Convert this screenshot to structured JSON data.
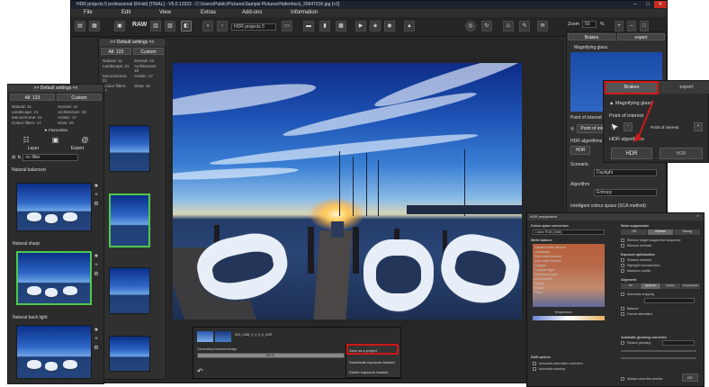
{
  "window": {
    "title": "HDR projects 5 professional (64-bit) [TRIAL] - V5.0.12933 - C:\\Users\\Public\\Pictures\\Sample Pictures\\Hafenhock_2564701h.jpg [+2]",
    "controls": [
      "–",
      "□",
      "✕"
    ]
  },
  "menu": [
    "File",
    "Edit",
    "View",
    "Extras",
    "Add-ons",
    "Information"
  ],
  "toolbar": {
    "raw_label": "RAW",
    "project_dropdown": "HDR projects 5",
    "zoom_label": "Zoom",
    "zoom_value": "50",
    "percent": "%"
  },
  "left_panel": {
    "header": ">> Default settings <<",
    "tabs": [
      "All: 123",
      "Custom"
    ],
    "categories": [
      [
        "Natural: 21",
        "Surreal: 13"
      ],
      [
        "Landscape: 21",
        "Architecture: 18"
      ],
      [
        "Monochrome: 21",
        "Artistic: 17"
      ],
      [
        "Colour filters: 17",
        "Glow: 16"
      ]
    ],
    "favourites": "Favourites",
    "layer_label": "Layer",
    "expert_label": "Expert",
    "filter_dropdown": "no filter",
    "presets": [
      "Natural balanced",
      "Natural sharp",
      "Natural back light"
    ]
  },
  "right_panel": {
    "tabs": [
      "Brakes",
      "expert"
    ],
    "magnifying_glass": "Magnifying glass",
    "point_of_interest": "Point of interest",
    "point_interest_btn": "Point of interest",
    "hdr_algorithms": "HDR algorithms",
    "hdr_label": "HDR",
    "scenarios": "Scenario",
    "scenario_value": "Daylight",
    "algorithm": "Algorithm",
    "algorithm_value": "Entropy",
    "colour_space": "Intelligent colour space (SCA method)"
  },
  "zoom_callout": {
    "tabs": [
      "Brakes",
      "expert"
    ],
    "magnifying_glass": "Magnifying glass",
    "point_of_interest": "Point of interest",
    "point_interest_btn": "Point of interest",
    "hdr_algorithms": "HDR algorithms",
    "hdr_label": "HDR",
    "hdr_label_alt": "HDR"
  },
  "dialog": {
    "title": "HDR preparation",
    "sections": {
      "colour_space": "Colour space conversion",
      "colour_space_value": "Linear RGB (16Bit)",
      "white_balance": "White balance",
      "wb_items": [
        "Camera white balance",
        "Landscape",
        "RAW white balance",
        "Auto white balance",
        "Daylight",
        "Tungsten light",
        "Fluorescent light",
        "Auto bracket",
        "Cloudy",
        "Shade",
        "Flash"
      ],
      "temperature": "Temperature",
      "noise_suppression": "Noise suppression",
      "noise_tabs": [
        "Off",
        "Normal",
        "Strong"
      ],
      "exposure_optimisation": "Exposure optimisation",
      "alignment": "Alignment",
      "alignment_tabs": [
        "Off",
        "Optimize",
        "Quality",
        "Professional"
      ],
      "ghosting_correction": "Automatic ghosting correction",
      "ghost_option": "Reduce ghosting",
      "raw_options": "RAW options",
      "show_after_loading": "Always show this window",
      "ok_label": "OK",
      "raw_checks": [
        "Automatic aberration correction",
        "Automatic shading"
      ],
      "checks": [
        "Remove single images from sequence",
        "Remove exif data",
        "Shadow recovery",
        "Highlight reconstruction",
        "Maximum quality",
        "Automatic cropping",
        "Balance",
        "Correct aberration"
      ]
    }
  },
  "bottom_popup": {
    "filename": "IMG_2368_3_4_5_6_HDR",
    "progress_label": "Generating bracketed image..",
    "progress_value": 100,
    "percent_label": "100 %"
  },
  "context_menu": {
    "items": [
      "Save as a project",
      "Deactivate exposure bracket",
      "Delete exposure bracket"
    ]
  },
  "colors": {
    "accent_red": "#d01818",
    "selection_green": "#4ec94e",
    "panel_dark": "#2b2b2b"
  }
}
